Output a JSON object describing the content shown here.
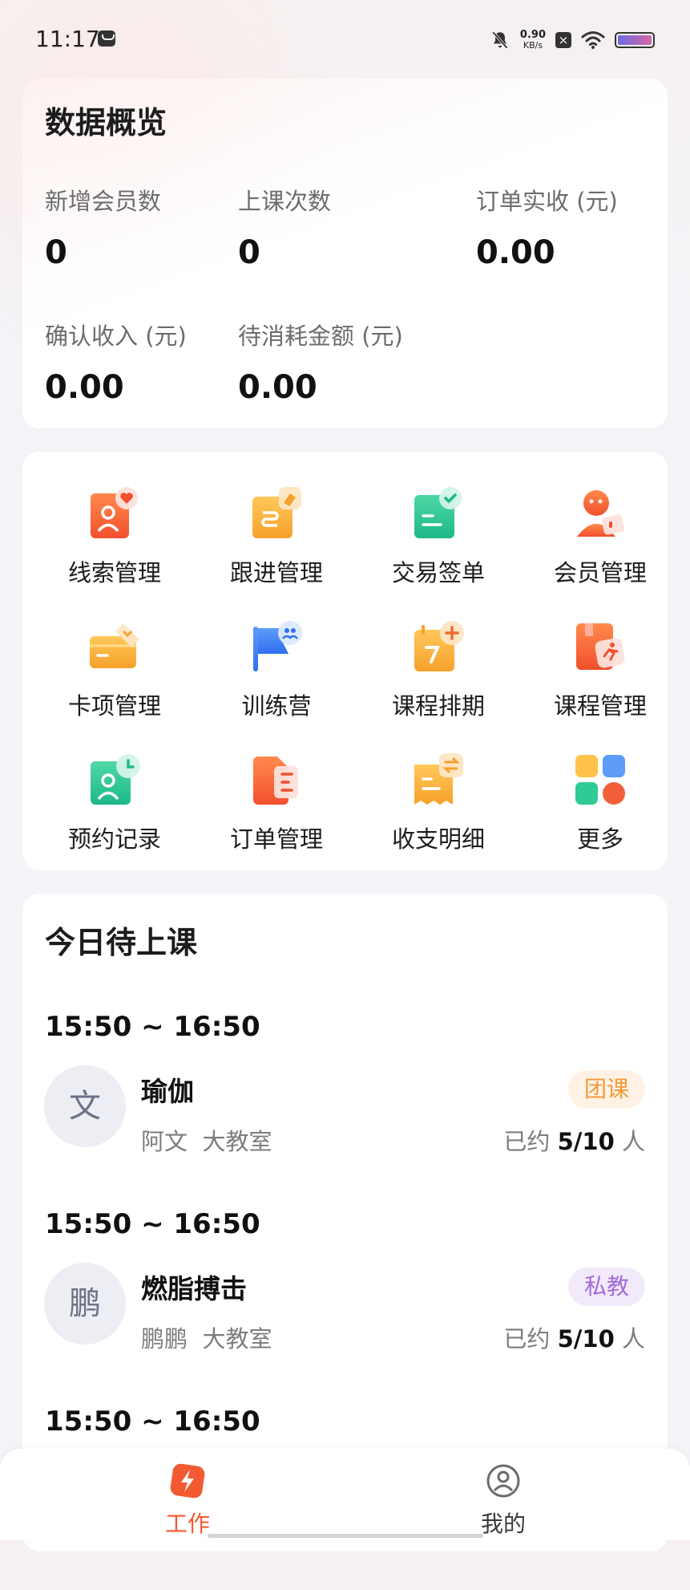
{
  "status_bar": {
    "time": "11:17",
    "net_speed_value": "0.90",
    "net_speed_unit": "KB/s"
  },
  "overview": {
    "title": "数据概览",
    "stats": [
      {
        "label": "新增会员数",
        "value": "0"
      },
      {
        "label": "上课次数",
        "value": "0"
      },
      {
        "label": "订单实收 (元)",
        "value": "0.00"
      },
      {
        "label": "确认收入 (元)",
        "value": "0.00"
      },
      {
        "label": "待消耗金额 (元)",
        "value": "0.00"
      }
    ]
  },
  "menu": {
    "items": [
      {
        "label": "线索管理",
        "icon": "lead-icon"
      },
      {
        "label": "跟进管理",
        "icon": "follow-up-icon"
      },
      {
        "label": "交易签单",
        "icon": "contract-icon"
      },
      {
        "label": "会员管理",
        "icon": "member-icon"
      },
      {
        "label": "卡项管理",
        "icon": "card-icon"
      },
      {
        "label": "训练营",
        "icon": "camp-flag-icon"
      },
      {
        "label": "课程排期",
        "icon": "schedule-icon"
      },
      {
        "label": "课程管理",
        "icon": "course-book-icon"
      },
      {
        "label": "预约记录",
        "icon": "booking-icon"
      },
      {
        "label": "订单管理",
        "icon": "order-icon"
      },
      {
        "label": "收支明细",
        "icon": "finance-icon"
      },
      {
        "label": "更多",
        "icon": "more-grid-icon"
      }
    ]
  },
  "today": {
    "title": "今日待上课",
    "booked_prefix": "已约",
    "booked_suffix": "人",
    "sessions": [
      {
        "time": "15:50 ~ 16:50",
        "avatar": "文",
        "name": "瑜伽",
        "coach": "阿文",
        "room": "大教室",
        "badge": "团课",
        "booked": "5/10"
      },
      {
        "time": "15:50 ~ 16:50",
        "avatar": "鹏",
        "name": "燃脂搏击",
        "coach": "鹏鹏",
        "room": "大教室",
        "badge": "私教",
        "booked": "5/10"
      },
      {
        "time": "15:50 ~ 16:50"
      }
    ]
  },
  "tabbar": {
    "tabs": [
      {
        "label": "工作",
        "active": true
      },
      {
        "label": "我的",
        "active": false
      }
    ]
  },
  "colors": {
    "accent": "#f25a32",
    "tab_active": "#f05a2e",
    "tab_inactive": "#3a3a3c",
    "badge_group": "#f39a3a",
    "badge_private": "#a56ad8"
  }
}
